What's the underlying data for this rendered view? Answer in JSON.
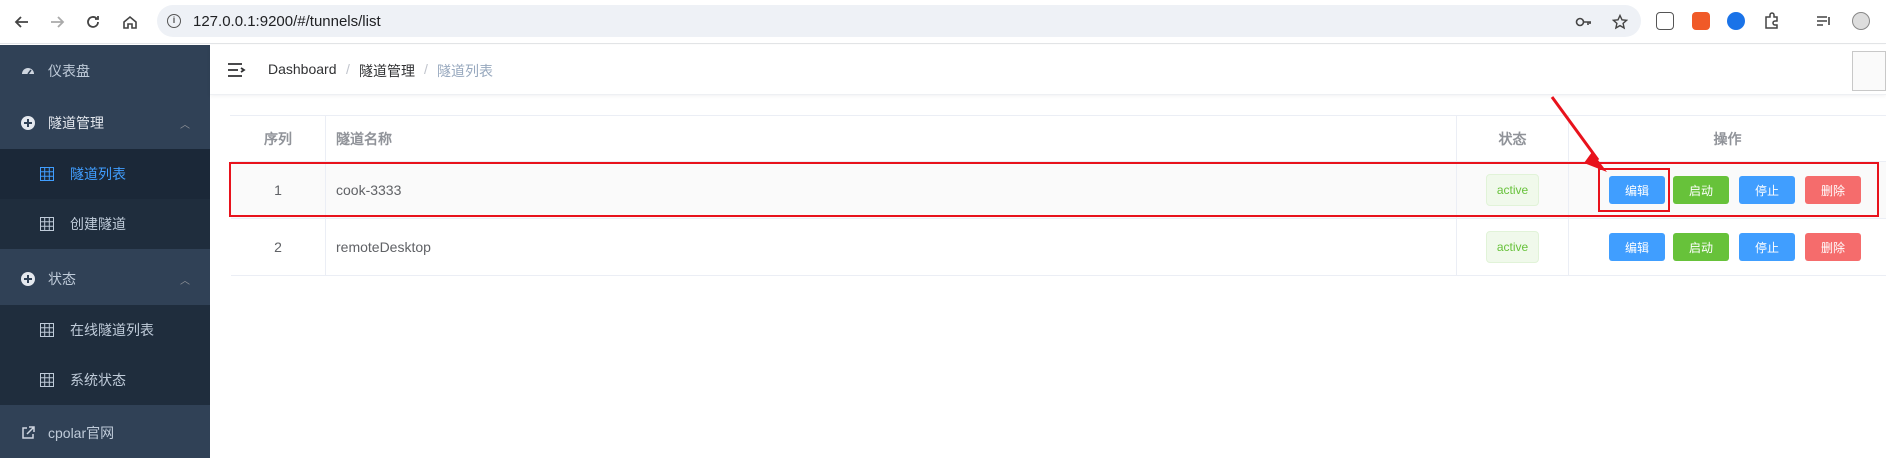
{
  "browser": {
    "url": "127.0.0.1:9200/#/tunnels/list"
  },
  "sidebar": {
    "dashboard": "仪表盘",
    "tunnel_mgmt": "隧道管理",
    "tunnel_list": "隧道列表",
    "create_tunnel": "创建隧道",
    "status": "状态",
    "online_tunnels": "在线隧道列表",
    "system_status": "系统状态",
    "cpolar_site": "cpolar官网"
  },
  "breadcrumb": {
    "home": "Dashboard",
    "sep1": "/",
    "section": "隧道管理",
    "sep2": "/",
    "current": "隧道列表"
  },
  "table": {
    "headers": {
      "index": "序列",
      "name": "隧道名称",
      "status": "状态",
      "actions": "操作"
    },
    "rows": [
      {
        "index": "1",
        "name": "cook-3333",
        "status": "active"
      },
      {
        "index": "2",
        "name": "remoteDesktop",
        "status": "active"
      }
    ],
    "buttons": {
      "edit": "编辑",
      "start": "启动",
      "stop": "停止",
      "delete": "删除"
    }
  },
  "colors": {
    "sidebar_bg": "#304156",
    "accent": "#409eff",
    "annotation": "#e8121c"
  }
}
